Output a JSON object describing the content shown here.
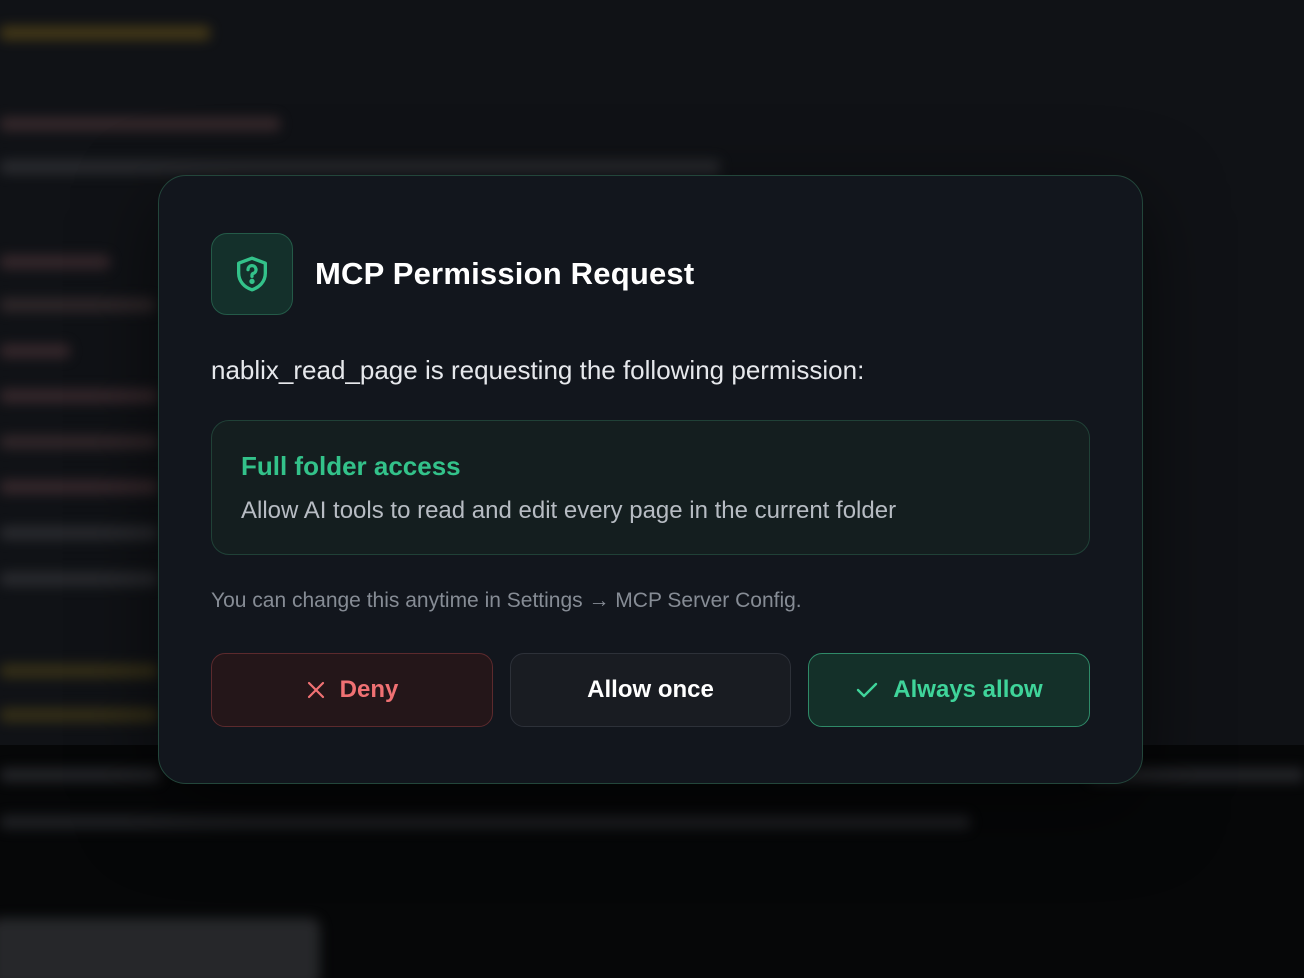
{
  "dialog": {
    "title": "MCP Permission Request",
    "header_icon": "shield-question-icon",
    "request_text": "nablix_read_page is requesting the following permission:",
    "permission": {
      "title": "Full folder access",
      "description": "Allow AI tools to read and edit every page in the current folder"
    },
    "hint": "You can change this anytime in Settings → MCP Server Config.",
    "buttons": {
      "deny": {
        "label": "Deny",
        "icon": "close-icon"
      },
      "allow_once": {
        "label": "Allow once"
      },
      "always_allow": {
        "label": "Always allow",
        "icon": "check-icon"
      }
    }
  },
  "colors": {
    "accent": "#33c28a",
    "danger": "#f07173",
    "modal_background": "#12161d",
    "page_background": "#0b0d11"
  }
}
